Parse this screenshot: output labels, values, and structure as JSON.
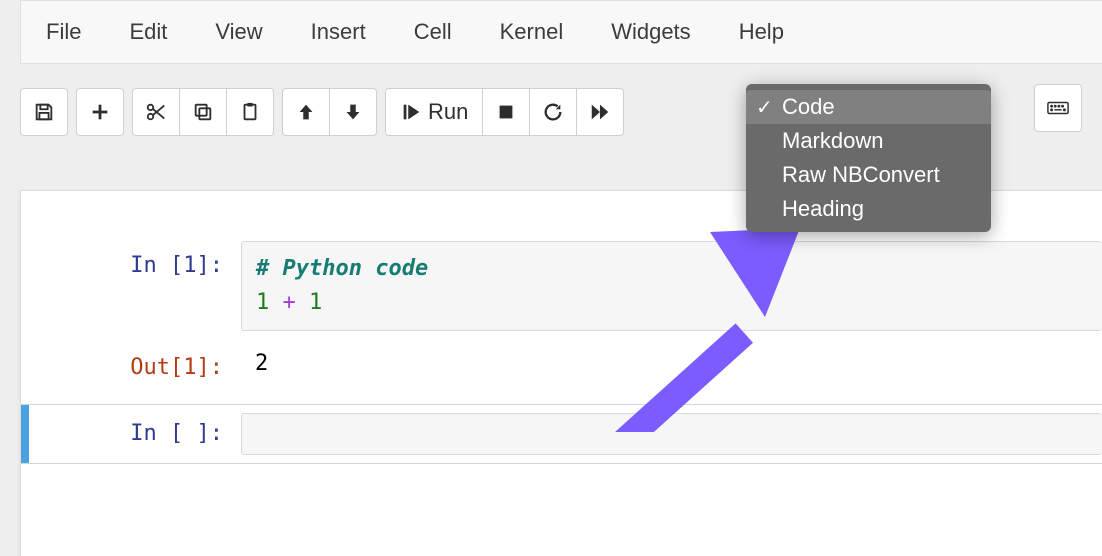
{
  "menu": {
    "file": "File",
    "edit": "Edit",
    "view": "View",
    "insert": "Insert",
    "cell": "Cell",
    "kernel": "Kernel",
    "widgets": "Widgets",
    "help": "Help"
  },
  "toolbar": {
    "run_label": "Run"
  },
  "dropdown": {
    "items": [
      {
        "label": "Code",
        "selected": true
      },
      {
        "label": "Markdown",
        "selected": false
      },
      {
        "label": "Raw NBConvert",
        "selected": false
      },
      {
        "label": "Heading",
        "selected": false
      }
    ]
  },
  "cells": {
    "c1": {
      "in_prompt": "In [1]:",
      "comment": "# Python code",
      "expr_left": "1",
      "expr_op": "+",
      "expr_right": "1",
      "out_prompt": "Out[1]:",
      "output": "2"
    },
    "c2": {
      "in_prompt": "In [ ]:"
    }
  }
}
